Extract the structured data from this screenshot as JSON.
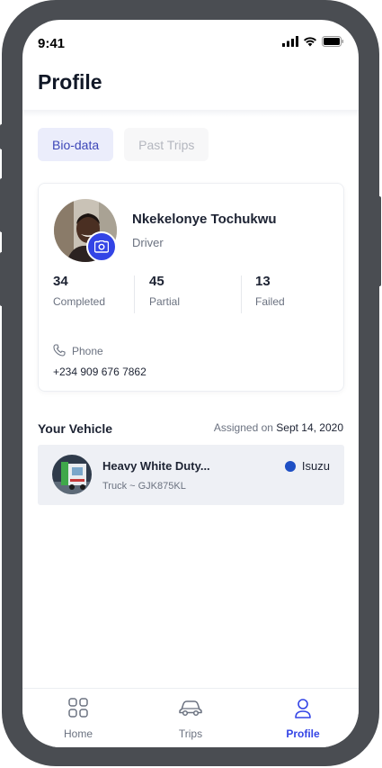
{
  "status_bar": {
    "time": "9:41"
  },
  "page": {
    "title": "Profile"
  },
  "tabs": [
    {
      "label": "Bio-data",
      "active": true
    },
    {
      "label": "Past Trips",
      "active": false
    }
  ],
  "profile": {
    "name": "Nkekelonye Tochukwu",
    "role": "Driver",
    "stats": [
      {
        "value": "34",
        "label": "Completed"
      },
      {
        "value": "45",
        "label": "Partial"
      },
      {
        "value": "13",
        "label": "Failed"
      }
    ],
    "phone_label": "Phone",
    "phone_number": "+234 909 676 7862"
  },
  "vehicle": {
    "section_title": "Your Vehicle",
    "assigned_prefix": "Assigned on",
    "assigned_date": "Sept 14, 2020",
    "name": "Heavy White Duty...",
    "subtitle": "Truck ~ GJK875KL",
    "brand": "Isuzu",
    "brand_color": "#1e4fc4"
  },
  "bottom_nav": [
    {
      "label": "Home",
      "icon": "grid-icon",
      "active": false
    },
    {
      "label": "Trips",
      "icon": "car-icon",
      "active": false
    },
    {
      "label": "Profile",
      "icon": "user-icon",
      "active": true
    }
  ],
  "colors": {
    "accent": "#3344e6",
    "tab_active_bg": "#ebedfb",
    "frame": "#4a4d52"
  }
}
